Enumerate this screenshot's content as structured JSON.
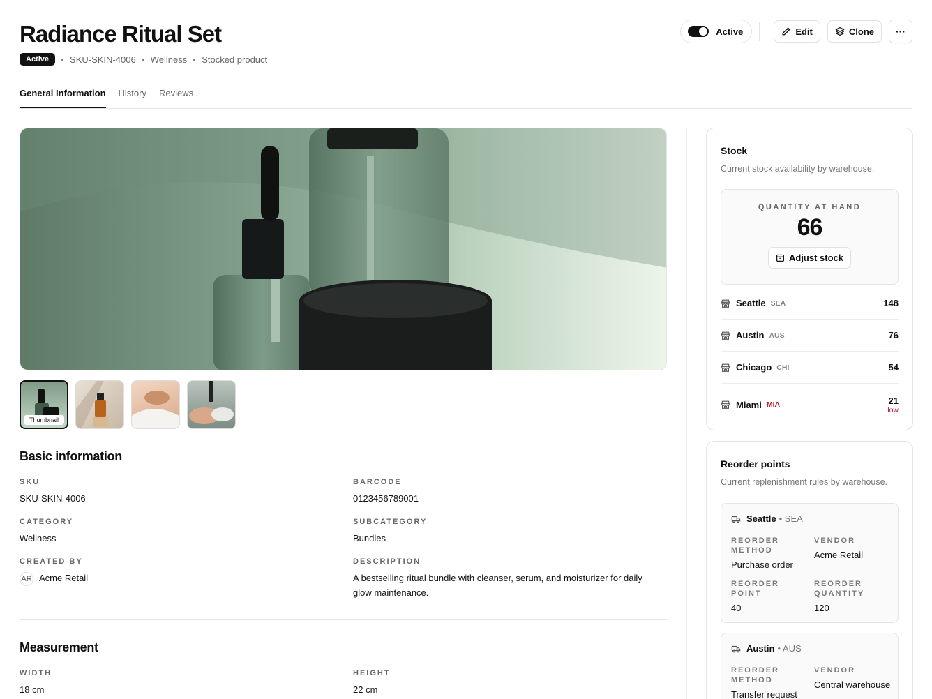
{
  "header": {
    "title": "Radiance Ritual Set",
    "status_badge": "Active",
    "sku": "SKU-SKIN-4006",
    "category": "Wellness",
    "product_type": "Stocked product",
    "toggle_label": "Active",
    "edit_label": "Edit",
    "clone_label": "Clone",
    "more_label": "···"
  },
  "tabs": [
    {
      "label": "General Information",
      "active": true
    },
    {
      "label": "History",
      "active": false
    },
    {
      "label": "Reviews",
      "active": false
    }
  ],
  "gallery": {
    "thumbnail_label": "Thumbnail"
  },
  "basic_info": {
    "title": "Basic information",
    "sku_label": "SKU",
    "sku_value": "SKU-SKIN-4006",
    "barcode_label": "BARCODE",
    "barcode_value": "0123456789001",
    "category_label": "CATEGORY",
    "category_value": "Wellness",
    "subcategory_label": "SUBCATEGORY",
    "subcategory_value": "Bundles",
    "created_by_label": "CREATED BY",
    "created_by_initials": "AR",
    "created_by_value": "Acme Retail",
    "description_label": "DESCRIPTION",
    "description_value": "A bestselling ritual bundle with cleanser, serum, and moisturizer for daily glow maintenance."
  },
  "measurement": {
    "title": "Measurement",
    "width_label": "WIDTH",
    "width_value": "18 cm",
    "height_label": "HEIGHT",
    "height_value": "22 cm"
  },
  "stock": {
    "title": "Stock",
    "subtitle": "Current stock availability by warehouse.",
    "qty_label": "QUANTITY AT HAND",
    "qty_value": "66",
    "adjust_label": "Adjust stock",
    "warehouses": [
      {
        "name": "Seattle",
        "code": "SEA",
        "qty": "148",
        "low": ""
      },
      {
        "name": "Austin",
        "code": "AUS",
        "qty": "76",
        "low": ""
      },
      {
        "name": "Chicago",
        "code": "CHI",
        "qty": "54",
        "low": ""
      },
      {
        "name": "Miami",
        "code": "MIA",
        "qty": "21",
        "low": "low"
      }
    ]
  },
  "reorder": {
    "title": "Reorder points",
    "subtitle": "Current replenishment rules by warehouse.",
    "rules": [
      {
        "name": "Seattle",
        "code": "• SEA",
        "method_label": "REORDER METHOD",
        "method": "Purchase order",
        "vendor_label": "VENDOR",
        "vendor": "Acme Retail",
        "point_label": "REORDER POINT",
        "point": "40",
        "quantity_label": "REORDER QUANTITY",
        "quantity": "120"
      },
      {
        "name": "Austin",
        "code": "• AUS",
        "method_label": "REORDER METHOD",
        "method": "Transfer request",
        "vendor_label": "VENDOR",
        "vendor": "Central warehouse"
      }
    ]
  },
  "colors": {
    "text": "#111111",
    "muted": "#666666",
    "border": "#e3e3e3",
    "danger": "#c8102e"
  }
}
